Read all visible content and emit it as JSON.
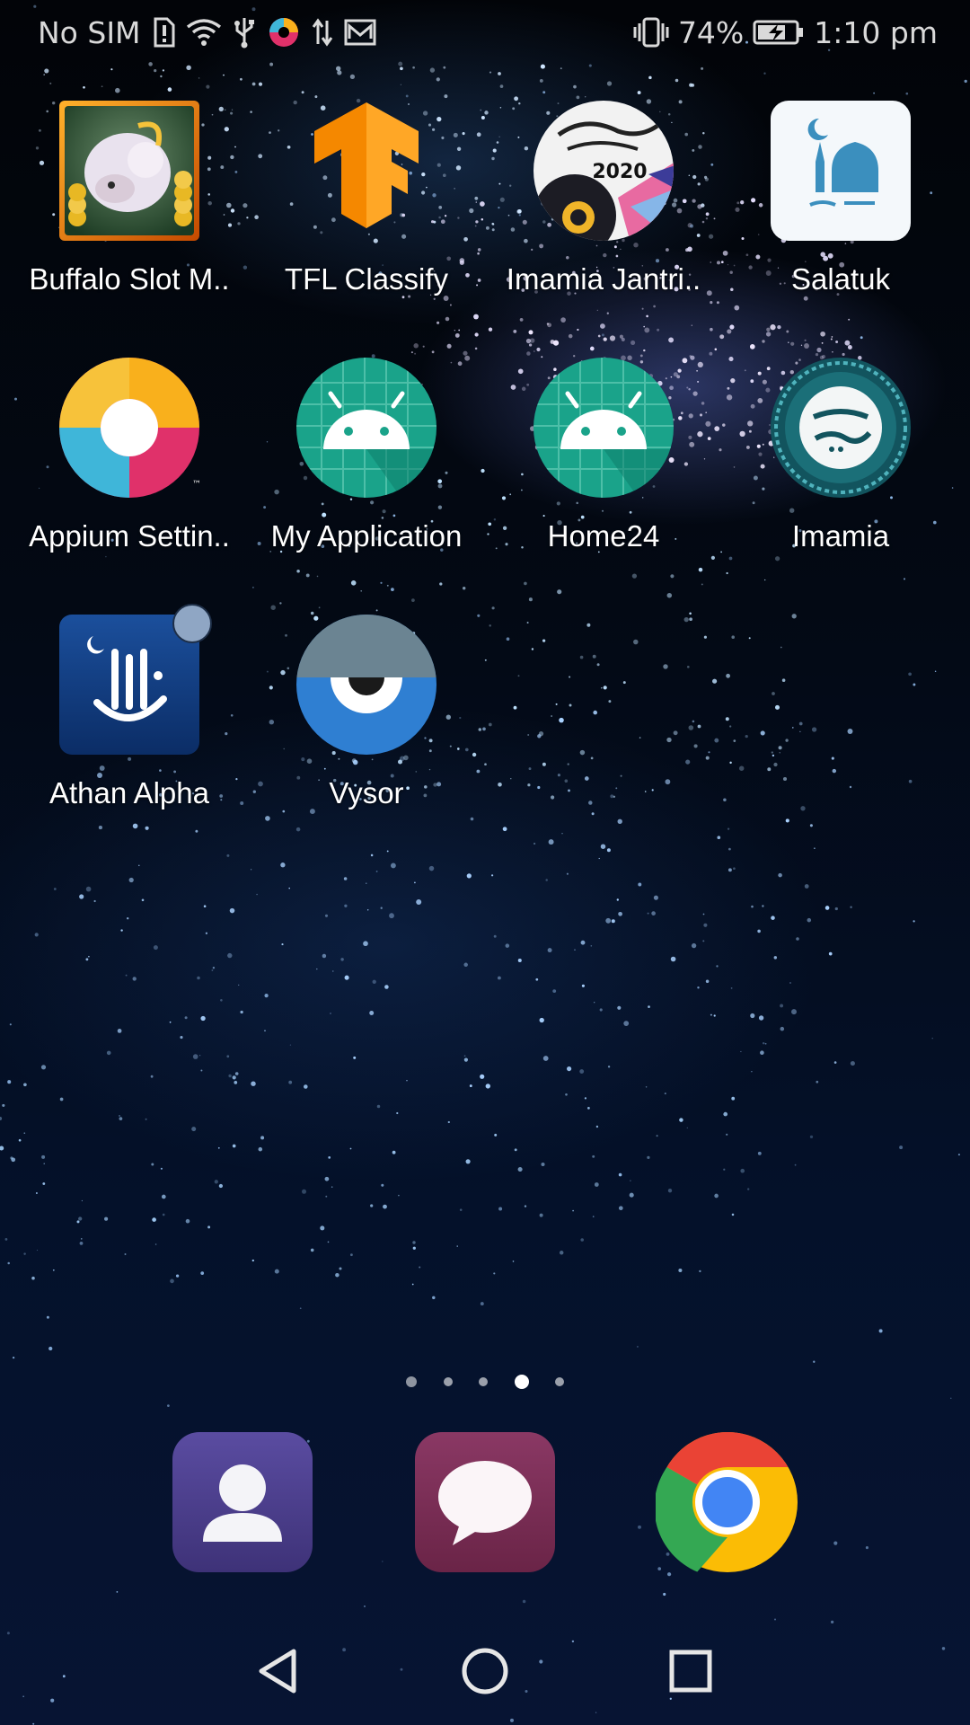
{
  "status_bar": {
    "carrier": "No SIM",
    "battery_percent": "74%",
    "time": "1:10 pm",
    "icons": [
      "sim-alert-icon",
      "wifi-icon",
      "usb-icon",
      "appium-notification-icon",
      "data-transfer-icon",
      "mail-icon",
      "vibrate-icon",
      "battery-charging-icon"
    ]
  },
  "apps": [
    {
      "label": "Buffalo Slot M..",
      "icon": "buffalo-slot-icon"
    },
    {
      "label": "TFL Classify",
      "icon": "tensorflow-icon"
    },
    {
      "label": "Imamia Jantri..",
      "icon": "imamia-jantri-2020-icon"
    },
    {
      "label": "Salatuk",
      "icon": "salatuk-mosque-icon"
    },
    {
      "label": "Appium Settin..",
      "icon": "appium-icon"
    },
    {
      "label": "My Application",
      "icon": "android-icon"
    },
    {
      "label": "Home24",
      "icon": "android-icon"
    },
    {
      "label": "Imamia",
      "icon": "imamia-seal-icon"
    },
    {
      "label": "Athan Alpha",
      "icon": "athan-icon"
    },
    {
      "label": "Vysor",
      "icon": "vysor-eye-icon"
    }
  ],
  "icon_text": {
    "jantri_year": "2020"
  },
  "page_indicator": {
    "pages": 5,
    "current_page": 4
  },
  "dock": [
    {
      "name": "contacts",
      "icon": "contacts-icon"
    },
    {
      "name": "messages",
      "icon": "messages-icon"
    },
    {
      "name": "chrome",
      "icon": "chrome-icon"
    }
  ],
  "nav": {
    "buttons": [
      "back",
      "home",
      "recents"
    ]
  },
  "colors": {
    "android_green": "#1aa38a",
    "tensorflow_orange": "#ff8f00",
    "contacts_purple": "#4b3f8c",
    "messages_maroon": "#7a2f55"
  }
}
